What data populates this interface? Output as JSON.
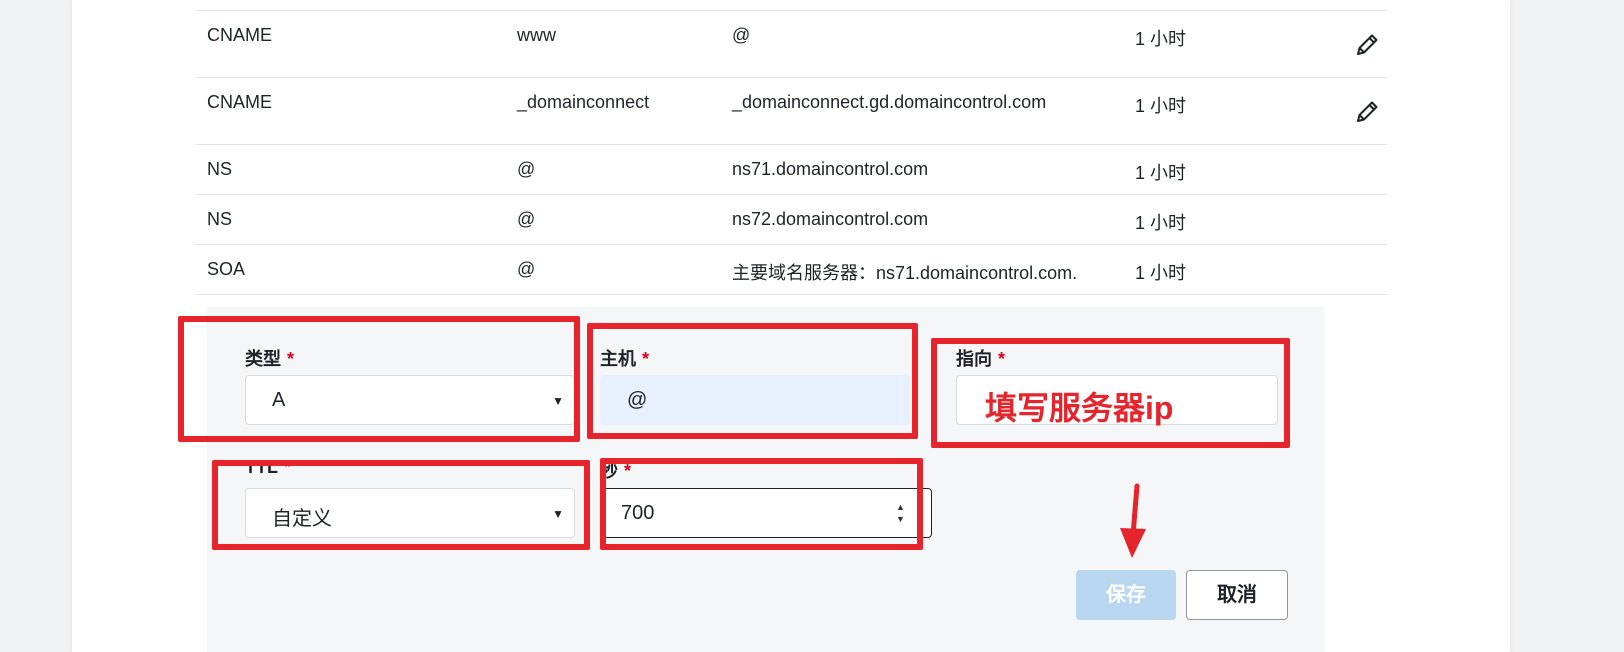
{
  "records": [
    {
      "type": "CNAME",
      "host": "www",
      "points_to": "@",
      "ttl": "1 小时",
      "editable": true
    },
    {
      "type": "CNAME",
      "host": "_domainconnect",
      "points_to": "_domainconnect.gd.domaincontrol.com",
      "ttl": "1 小时",
      "editable": true
    },
    {
      "type": "NS",
      "host": "@",
      "points_to": "ns71.domaincontrol.com",
      "ttl": "1 小时",
      "editable": false
    },
    {
      "type": "NS",
      "host": "@",
      "points_to": "ns72.domaincontrol.com",
      "ttl": "1 小时",
      "editable": false
    },
    {
      "type": "SOA",
      "host": "@",
      "points_to": "主要域名服务器：ns71.domaincontrol.com.",
      "ttl": "1 小时",
      "editable": false
    }
  ],
  "form": {
    "type_label": "类型",
    "type_value": "A",
    "host_label": "主机",
    "host_value": "@",
    "points_label": "指向",
    "points_hint": "填写服务器ip",
    "ttl_label": "TTL",
    "ttl_value": "自定义",
    "seconds_label": "秒",
    "seconds_value": "700",
    "required_mark": "*",
    "save_label": "保存",
    "cancel_label": "取消"
  },
  "icons": {
    "edit": "pencil-icon",
    "select": "caret-down-icon",
    "spinner": "spinner-arrows-icon",
    "annotation": "red-arrow-icon"
  },
  "colors": {
    "annotation_red": "#e5242b",
    "required_red": "#d6001c",
    "save_disabled_bg": "#b9d6f0",
    "host_field_bg": "#e8f0fe"
  }
}
